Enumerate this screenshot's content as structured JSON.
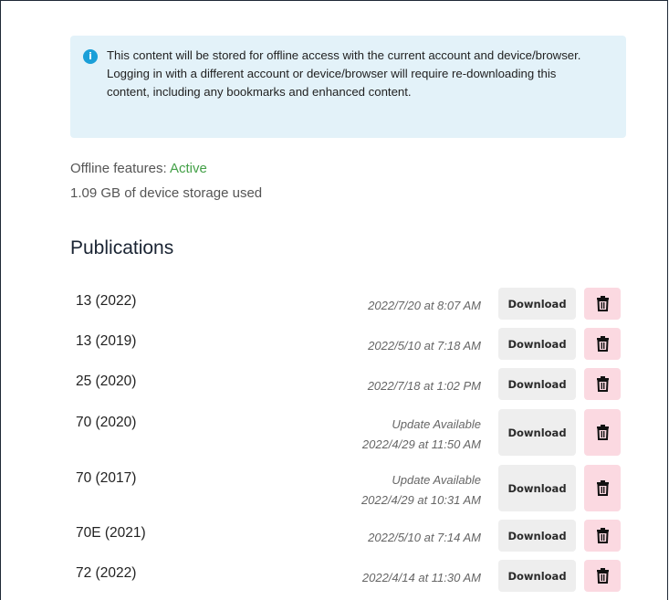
{
  "info": {
    "icon": "info-icon",
    "text": "This content will be stored for offline access with the current account and device/browser. Logging in with a different account or device/browser will require re-downloading this content, including any bookmarks and enhanced content."
  },
  "offline": {
    "label": "Offline features: ",
    "status": "Active",
    "status_color": "#43a047",
    "storage": "1.09 GB of device storage used"
  },
  "publications": {
    "title": "Publications",
    "download_label": "Download",
    "items": [
      {
        "name": "13 (2022)",
        "update": "",
        "date": "2022/7/20 at 8:07 AM"
      },
      {
        "name": "13 (2019)",
        "update": "",
        "date": "2022/5/10 at 7:18 AM"
      },
      {
        "name": "25 (2020)",
        "update": "",
        "date": "2022/7/18 at 1:02 PM"
      },
      {
        "name": "70 (2020)",
        "update": "Update Available",
        "date": "2022/4/29 at 11:50 AM"
      },
      {
        "name": "70 (2017)",
        "update": "Update Available",
        "date": "2022/4/29 at 10:31 AM"
      },
      {
        "name": "70E (2021)",
        "update": "",
        "date": "2022/5/10 at 7:14 AM"
      },
      {
        "name": "72 (2022)",
        "update": "",
        "date": "2022/4/14 at 11:30 AM"
      }
    ]
  },
  "colors": {
    "info_bg": "#e3f2f9",
    "info_icon": "#1a9fd8",
    "download_bg": "#eeeeee",
    "delete_bg": "#fbd9e1"
  }
}
